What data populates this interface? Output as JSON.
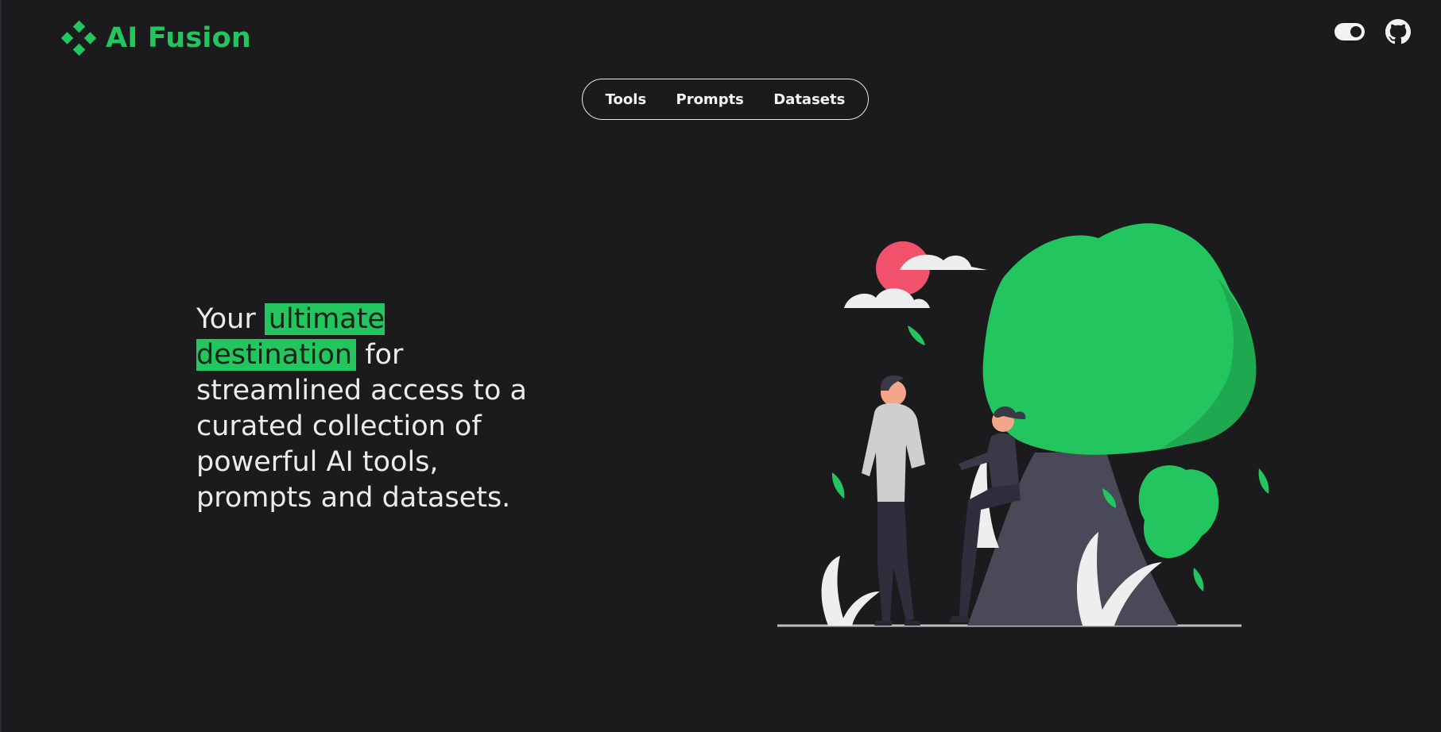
{
  "brand": {
    "name": "AI Fusion",
    "logo_icon": "four-diamond-logo-icon",
    "accent_color": "#22c55e"
  },
  "header": {
    "theme_toggle_icon": "theme-toggle-icon",
    "github_icon": "github-icon"
  },
  "nav": {
    "items": [
      {
        "label": "Tools"
      },
      {
        "label": "Prompts"
      },
      {
        "label": "Datasets"
      }
    ]
  },
  "hero": {
    "text_before": "Your",
    "highlight": "ultimate destination",
    "text_after": "for streamlined access to a curated collection of powerful AI tools, prompts and datasets."
  },
  "illustration": {
    "name": "couple-under-tree-illustration"
  },
  "colors": {
    "background": "#1b1b1e",
    "text": "#f2f2f2",
    "accent": "#22c55e",
    "sun": "#f1516b"
  }
}
